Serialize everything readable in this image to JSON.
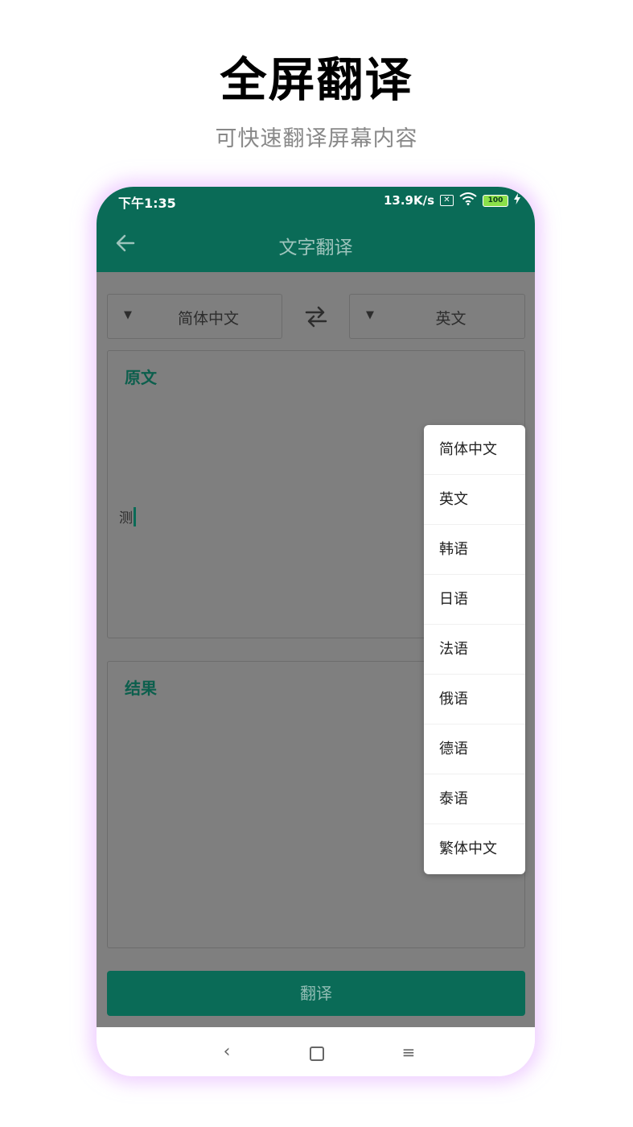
{
  "promo": {
    "title": "全屏翻译",
    "subtitle": "可快速翻译屏幕内容"
  },
  "status_bar": {
    "time": "下午1:35",
    "net_speed": "13.9K/s",
    "sim_icon": "✕",
    "battery": "100",
    "icons": [
      "sim-off-icon",
      "wifi-icon",
      "battery-icon",
      "charging-bolt-icon"
    ]
  },
  "app_bar": {
    "title": "文字翻译",
    "back_icon": "arrow-left-icon"
  },
  "language_selector": {
    "source": "简体中文",
    "target": "英文",
    "swap_icon": "swap-arrows-icon"
  },
  "source_box": {
    "label": "原文",
    "text": "测"
  },
  "result_box": {
    "label": "结果",
    "text": ""
  },
  "translate_button": "翻译",
  "dropdown": {
    "items": [
      "简体中文",
      "英文",
      "韩语",
      "日语",
      "法语",
      "俄语",
      "德语",
      "泰语",
      "繁体中文"
    ]
  },
  "nav_bar": {
    "back": "‹",
    "menu": "≡"
  },
  "colors": {
    "primary": "#0a6b57",
    "overlay": "#7f7f7f",
    "label_green": "#0c5f4d",
    "glow": "#e1aaff"
  }
}
